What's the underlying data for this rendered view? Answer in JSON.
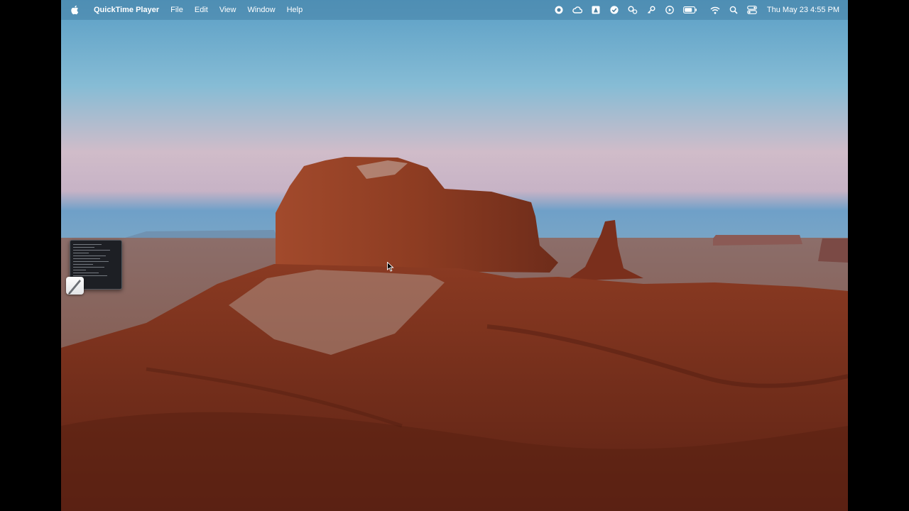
{
  "menubar": {
    "app_name": "QuickTime Player",
    "menus": [
      "File",
      "Edit",
      "View",
      "Window",
      "Help"
    ],
    "clock": "Thu May 23  4:55 PM",
    "status_icons": [
      "screen-record-icon",
      "cloud-icon",
      "font-app-icon",
      "check-icon",
      "gears-icon",
      "key-icon",
      "play-circle-icon",
      "battery-icon",
      "wifi-icon",
      "spotlight-search-icon",
      "control-center-icon"
    ]
  },
  "desktop": {
    "wallpaper": "monument-valley-butte",
    "colors": {
      "sky_top": "#5fa3c9",
      "sky_horizon": "#d6b9c4",
      "rock": "#8e3a22",
      "ground": "#6e2a18"
    }
  }
}
